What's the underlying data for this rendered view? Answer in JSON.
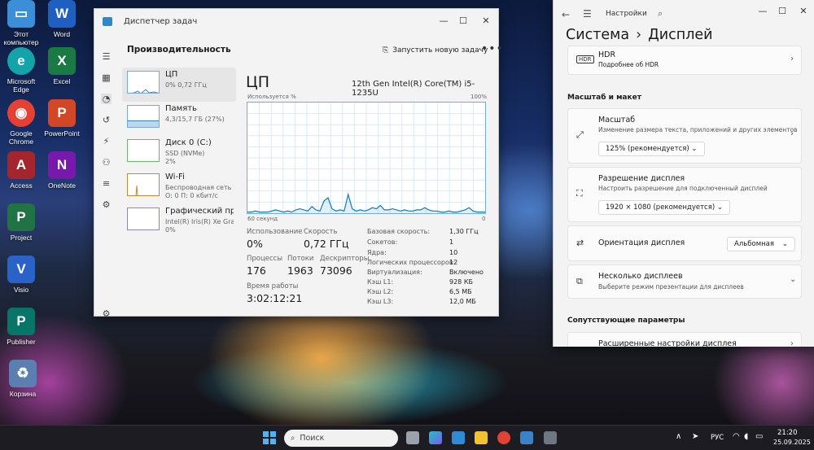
{
  "desktop": {
    "icons": [
      {
        "label": "Этот компьютер",
        "glyph": "▭",
        "color": "#3b8fd9"
      },
      {
        "label": "Word",
        "glyph": "W",
        "color": "#1f5fbf"
      },
      {
        "label": "Microsoft Edge",
        "glyph": "e",
        "color": "#13a3a8"
      },
      {
        "label": "Excel",
        "glyph": "X",
        "color": "#1b7a43"
      },
      {
        "label": "Google Chrome",
        "glyph": "◉",
        "color": "#e34133"
      },
      {
        "label": "PowerPoint",
        "glyph": "P",
        "color": "#d24726"
      },
      {
        "label": "Access",
        "glyph": "A",
        "color": "#a4262c"
      },
      {
        "label": "OneNote",
        "glyph": "N",
        "color": "#7719aa"
      },
      {
        "label": "Project",
        "glyph": "P",
        "color": "#217346"
      },
      {
        "label": "Visio",
        "glyph": "V",
        "color": "#2b62c8"
      },
      {
        "label": "Publisher",
        "glyph": "P",
        "color": "#077568"
      },
      {
        "label": "Корзина",
        "glyph": "♻",
        "color": "#5a7fb0"
      }
    ]
  },
  "task_manager": {
    "title": "Диспетчер задач",
    "section": "Производительность",
    "run_new_task": "Запустить новую задачу",
    "more": "•••",
    "resources": [
      {
        "name": "ЦП",
        "s1": "0% 0,72 ГГц",
        "s2": ""
      },
      {
        "name": "Память",
        "s1": "4,3/15,7 ГБ (27%)",
        "s2": ""
      },
      {
        "name": "Диск 0 (C:)",
        "s1": "SSD (NVMe)",
        "s2": "2%"
      },
      {
        "name": "Wi-Fi",
        "s1": "Беспроводная сеть",
        "s2": "О: 0 П: 0 кбит/с"
      },
      {
        "name": "Графический процессор",
        "s1": "Intel(R) Iris(R) Xe Graphics",
        "s2": "0%"
      }
    ],
    "cpu": {
      "title": "ЦП",
      "model": "12th Gen Intel(R) Core(TM) i5-1235U",
      "graph_label_left": "Используется %",
      "graph_label_right": "100%",
      "graph_bottom_left": "60 секунд",
      "graph_bottom_right": "0",
      "usage_series": [
        1,
        1,
        2,
        1,
        1,
        1,
        2,
        3,
        2,
        1,
        2,
        1,
        3,
        4,
        3,
        2,
        6,
        3,
        2,
        11,
        14,
        4,
        2,
        3,
        2,
        17,
        4,
        2,
        3,
        2,
        3,
        5,
        4,
        7,
        3,
        3,
        4,
        3,
        2,
        3,
        2,
        2,
        3,
        3,
        5,
        3,
        2,
        2,
        1,
        1,
        2,
        1,
        1,
        2,
        3,
        5,
        2,
        1,
        1,
        1
      ],
      "stats": {
        "usage_label": "Использование",
        "usage": "0%",
        "speed_label": "Скорость",
        "speed": "0,72 ГГц",
        "processes_label": "Процессы",
        "processes": "176",
        "threads_label": "Потоки",
        "threads": "1963",
        "handles_label": "Дескрипторы",
        "handles": "73096",
        "uptime_label": "Время работы",
        "uptime": "3:02:12:21"
      },
      "specs": [
        {
          "label": "Базовая скорость:",
          "value": "1,30 ГГц"
        },
        {
          "label": "Сокетов:",
          "value": "1"
        },
        {
          "label": "Ядра:",
          "value": "10"
        },
        {
          "label": "Логических процессоров:",
          "value": "12"
        },
        {
          "label": "Виртуализация:",
          "value": "Включено"
        },
        {
          "label": "Кэш L1:",
          "value": "928 КБ"
        },
        {
          "label": "Кэш L2:",
          "value": "6,5 МБ"
        },
        {
          "label": "Кэш L3:",
          "value": "12,0 МБ"
        }
      ]
    }
  },
  "settings": {
    "app_name": "Настройки",
    "breadcrumb_parent": "Система",
    "breadcrumb_sep": "›",
    "breadcrumb_current": "Дисплей",
    "hdr": {
      "title": "HDR",
      "sub": "Подробнее об HDR"
    },
    "section_scale": "Масштаб и макет",
    "scale": {
      "title": "Масштаб",
      "sub": "Изменение размера текста, приложений и других элементов",
      "value": "125% (рекомендуется)"
    },
    "resolution": {
      "title": "Разрешение дисплея",
      "sub": "Настроить разрешение для подключенный дисплей",
      "value": "1920 × 1080 (рекомендуется)"
    },
    "orientation": {
      "title": "Ориентация дисплея",
      "value": "Альбомная"
    },
    "multi": {
      "title": "Несколько дисплеев",
      "sub": "Выберите режим презентации для дисплеев"
    },
    "section_related": "Сопутствующие параметры",
    "advanced": {
      "title": "Расширенные настройки дисплея"
    }
  },
  "taskbar": {
    "search_placeholder": "Поиск",
    "lang": "РУС",
    "time": "21:20",
    "date": "25.09.2025"
  }
}
